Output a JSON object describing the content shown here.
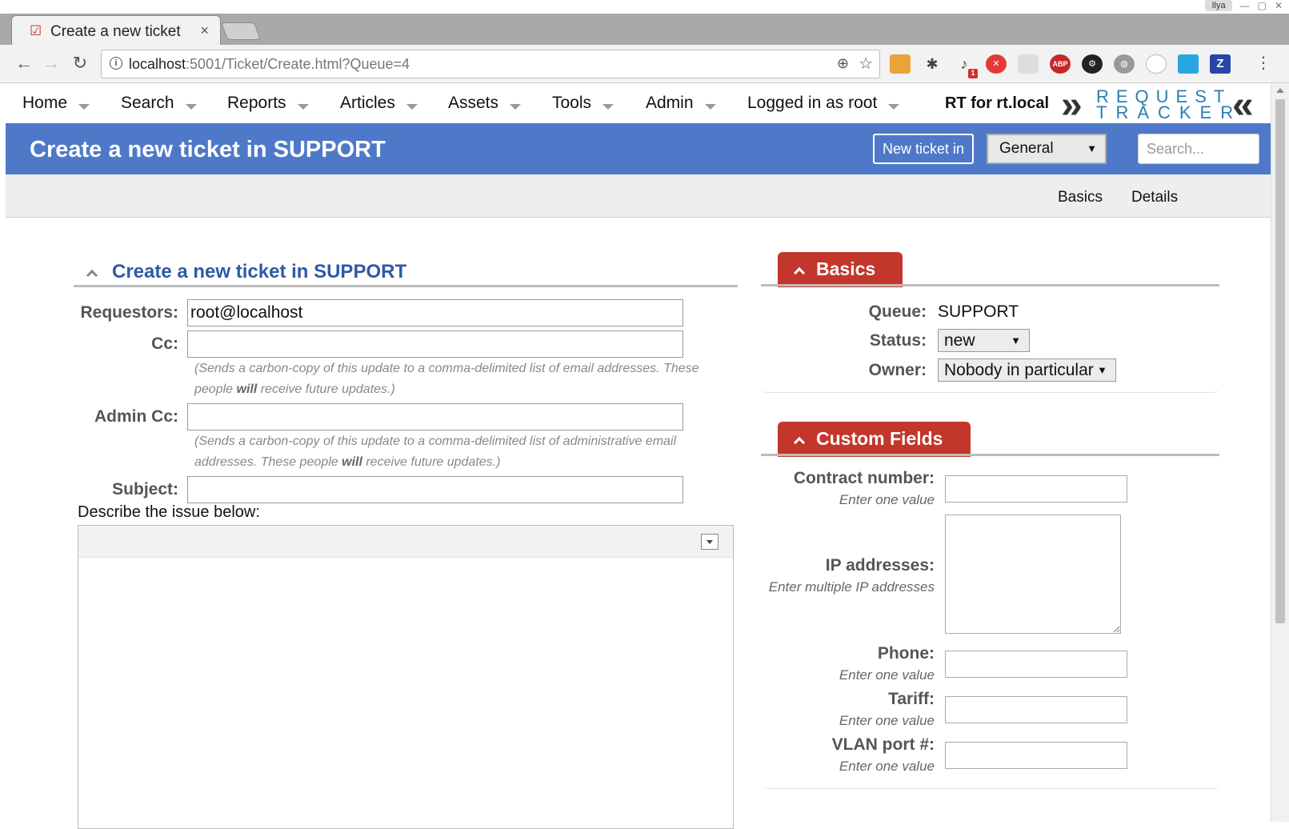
{
  "browser": {
    "tab_title": "Create a new ticket",
    "tab_close": "×",
    "profile_name": "Ilya",
    "url_host": "localhost",
    "url_rest": ":5001/Ticket/Create.html?Queue=4",
    "extension_badge": "1"
  },
  "menu": {
    "items": [
      "Home",
      "Search",
      "Reports",
      "Articles",
      "Assets",
      "Tools",
      "Admin",
      "Logged in as root"
    ],
    "host": "RT for rt.local",
    "logo_line1": "REQUEST",
    "logo_line2": "TRACKER"
  },
  "header": {
    "title": "Create a new ticket in SUPPORT",
    "new_ticket_label": "New ticket in",
    "queue_selected": "General",
    "search_placeholder": "Search..."
  },
  "subnav": {
    "basics": "Basics",
    "details": "Details"
  },
  "form": {
    "section_title": "Create a new ticket in SUPPORT",
    "requestors_label": "Requestors:",
    "requestors_value": "root@localhost",
    "cc_label": "Cc:",
    "cc_hint_1": "(Sends a carbon-copy of this update to a comma-delimited list of email addresses. These",
    "cc_hint_2a": "people ",
    "cc_hint_2b": "will",
    "cc_hint_2c": " receive future updates.)",
    "admincc_label": "Admin Cc:",
    "admincc_hint_1": "(Sends a carbon-copy of this update to a comma-delimited list of administrative email",
    "admincc_hint_2a": "addresses. These people ",
    "admincc_hint_2b": "will",
    "admincc_hint_2c": " receive future updates.)",
    "subject_label": "Subject:",
    "describe_label": "Describe the issue below:"
  },
  "basics": {
    "title": "Basics",
    "queue_label": "Queue:",
    "queue_value": "SUPPORT",
    "status_label": "Status:",
    "status_value": "new",
    "owner_label": "Owner:",
    "owner_value": "Nobody in particular"
  },
  "custom_fields": {
    "title": "Custom Fields",
    "contract_label": "Contract number:",
    "contract_hint": "Enter one value",
    "ip_label": "IP addresses:",
    "ip_hint": "Enter multiple IP addresses",
    "phone_label": "Phone:",
    "phone_hint": "Enter one value",
    "tariff_label": "Tariff:",
    "tariff_hint": "Enter one value",
    "vlan_label": "VLAN port #:",
    "vlan_hint": "Enter one value"
  },
  "colors": {
    "header_blue": "#4e79c8",
    "section_red": "#c3362b",
    "link_blue": "#2f5aa8"
  }
}
